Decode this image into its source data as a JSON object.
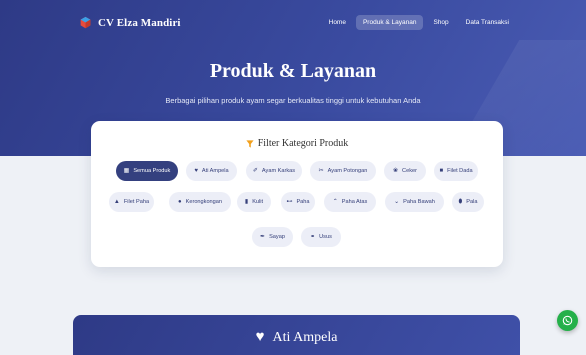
{
  "navbar": {
    "brand": "CV Elza Mandiri",
    "items": [
      {
        "label": "Home",
        "active": false
      },
      {
        "label": "Produk & Layanan",
        "active": true
      },
      {
        "label": "Shop",
        "active": false
      },
      {
        "label": "Data Transaksi",
        "active": false
      }
    ]
  },
  "hero": {
    "title": "Produk & Layanan",
    "subtitle": "Berbagai pilihan produk ayam segar berkualitas tinggi untuk kebutuhan Anda"
  },
  "filter": {
    "title": "Filter Kategori Produk",
    "title_icon": "funnel-icon",
    "chips": [
      {
        "label": "Semua Produk",
        "icon": "grid-icon",
        "active": true
      },
      {
        "label": "Ati Ampela",
        "icon": "heart-icon",
        "active": false
      },
      {
        "label": "Ayam Karkas",
        "icon": "drumstick-icon",
        "active": false
      },
      {
        "label": "Ayam Potongan",
        "icon": "scissors-icon",
        "active": false
      },
      {
        "label": "Ceker",
        "icon": "paw-icon",
        "active": false
      },
      {
        "label": "Filet Dada",
        "icon": "square-icon",
        "active": false
      },
      {
        "label": "Filet Paha",
        "icon": "weights-icon",
        "active": false
      },
      {
        "label": "Kerongkongan",
        "icon": "circle-icon",
        "active": false
      },
      {
        "label": "Kulit",
        "icon": "layer-icon",
        "active": false
      },
      {
        "label": "Paha",
        "icon": "bone-icon",
        "active": false
      },
      {
        "label": "Paha Atas",
        "icon": "chevron-up-icon",
        "active": false
      },
      {
        "label": "Paha Bawah",
        "icon": "chevron-down-icon",
        "active": false
      },
      {
        "label": "Pala",
        "icon": "egg-icon",
        "active": false
      },
      {
        "label": "Sayap",
        "icon": "feather-icon",
        "active": false
      },
      {
        "label": "Usus",
        "icon": "link-icon",
        "active": false
      }
    ]
  },
  "section": {
    "title": "Ati Ampela",
    "icon": "heart-icon"
  },
  "colors": {
    "primary": "#34407f",
    "chip_bg": "#eceef7",
    "filter_icon": "#f2a01c",
    "whatsapp": "#25b04a"
  }
}
